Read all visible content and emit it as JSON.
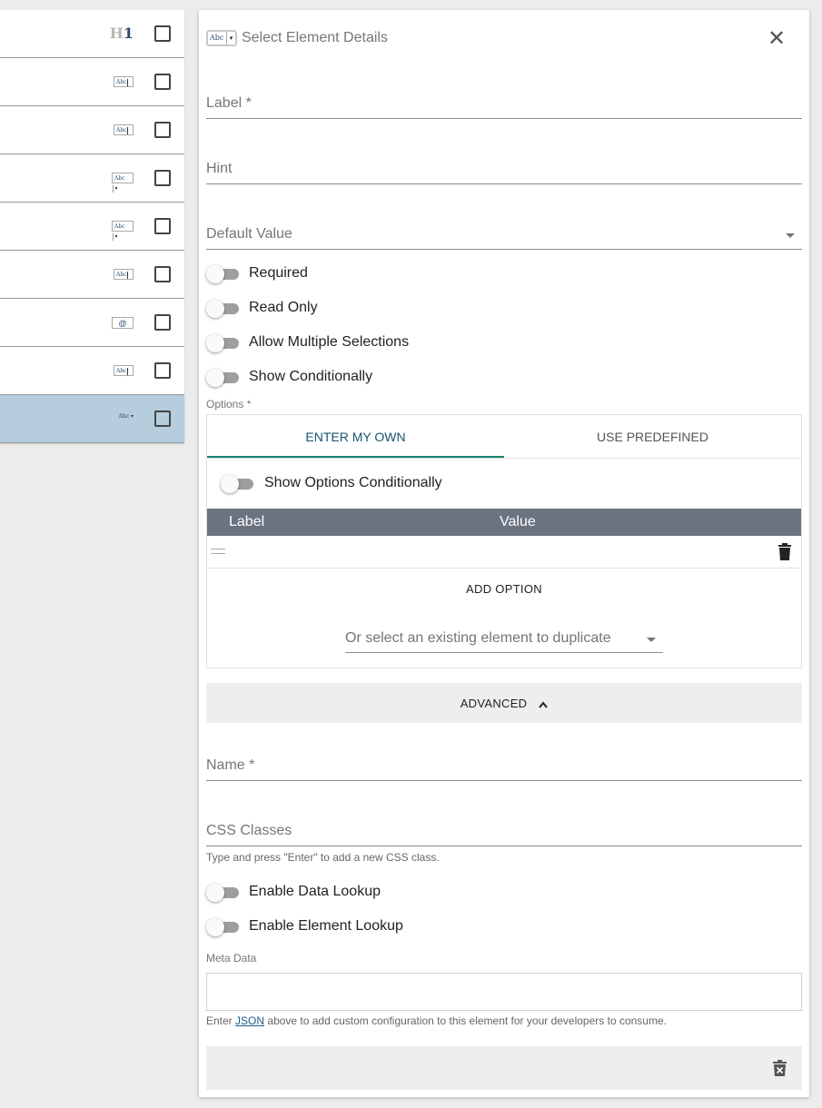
{
  "left_list": {
    "items": [
      {
        "icon": "heading-icon",
        "icon_text_h": "H",
        "icon_text_1": "1"
      },
      {
        "icon": "textbox-icon",
        "icon_text": "Abc"
      },
      {
        "icon": "textbox-icon",
        "icon_text": "Abc"
      },
      {
        "icon": "select-icon",
        "icon_text": "Abc"
      },
      {
        "icon": "select-icon",
        "icon_text": "Abc"
      },
      {
        "icon": "textbox-icon",
        "icon_text": "Abc"
      },
      {
        "icon": "email-icon",
        "icon_text": "@"
      },
      {
        "icon": "textbox-icon",
        "icon_text": "Abc"
      },
      {
        "icon": "select-icon",
        "icon_text": "Abc",
        "selected": true
      }
    ]
  },
  "panel": {
    "header_icon_text": "Abc",
    "header_icon_caret": "▾",
    "title": "Select Element Details",
    "close_glyph": "✕",
    "fields": {
      "label": "Label *",
      "hint": "Hint",
      "default_value": "Default Value"
    },
    "toggles": {
      "required": "Required",
      "read_only": "Read Only",
      "allow_multiple": "Allow Multiple Selections",
      "show_conditionally": "Show Conditionally"
    },
    "options": {
      "label": "Options *",
      "tab_own": "ENTER MY OWN",
      "tab_predefined": "USE PREDEFINED",
      "show_options_conditionally": "Show Options Conditionally",
      "col_label": "Label",
      "col_value": "Value",
      "add_option": "ADD OPTION",
      "duplicate_placeholder": "Or select an existing element to duplicate"
    },
    "advanced": {
      "label": "ADVANCED",
      "chevron": "⌃",
      "name": "Name *",
      "css_classes": "CSS Classes",
      "css_helper": "Type and press \"Enter\" to add a new CSS class.",
      "enable_data_lookup": "Enable Data Lookup",
      "enable_element_lookup": "Enable Element Lookup",
      "meta_data": "Meta Data",
      "meta_helper_pre": "Enter",
      "meta_helper_link": "JSON",
      "meta_helper_post": "above to add custom configuration to this element for your developers to consume."
    }
  },
  "colors": {
    "accent": "#16536e",
    "tab_indicator": "#16836f",
    "selected_item": "#b5cddd",
    "table_header": "#6b7280"
  }
}
